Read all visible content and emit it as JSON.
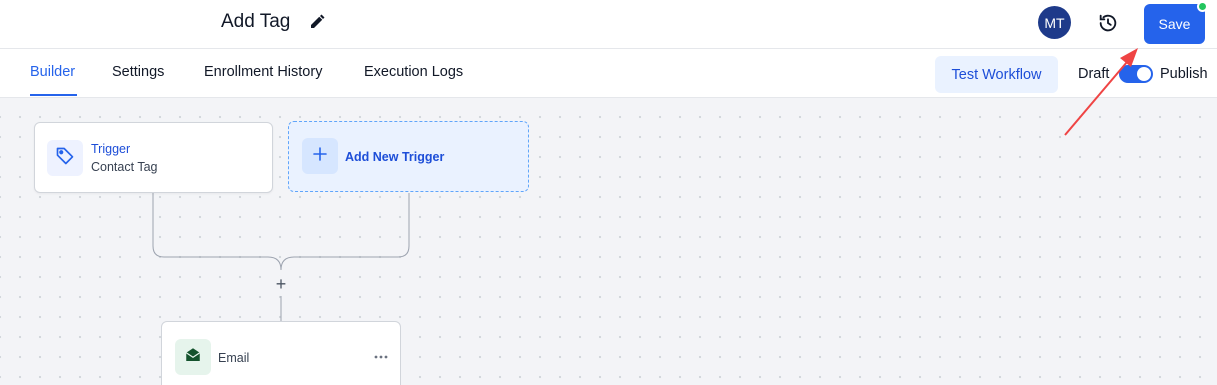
{
  "header": {
    "title": "Add Tag",
    "avatar_initials": "MT",
    "save_label": "Save",
    "accent_color": "#2563eb",
    "status_dot_color": "#22c55e"
  },
  "tabs": [
    {
      "label": "Builder",
      "active": true
    },
    {
      "label": "Settings",
      "active": false
    },
    {
      "label": "Enrollment History",
      "active": false
    },
    {
      "label": "Execution Logs",
      "active": false
    }
  ],
  "actions": {
    "test_workflow_label": "Test Workflow",
    "draft_label": "Draft",
    "publish_label": "Publish",
    "publish_toggle_on": true
  },
  "workflow": {
    "trigger": {
      "title": "Trigger",
      "subtitle": "Contact Tag",
      "icon": "tag-icon"
    },
    "add_trigger": {
      "label": "Add New Trigger",
      "icon": "plus-icon"
    },
    "add_step_symbol": "+",
    "email_step": {
      "label": "Email",
      "icon": "email-icon"
    }
  },
  "icons": {
    "edit": "pencil-icon",
    "history": "history-icon",
    "more": "more-horizontal-icon"
  }
}
